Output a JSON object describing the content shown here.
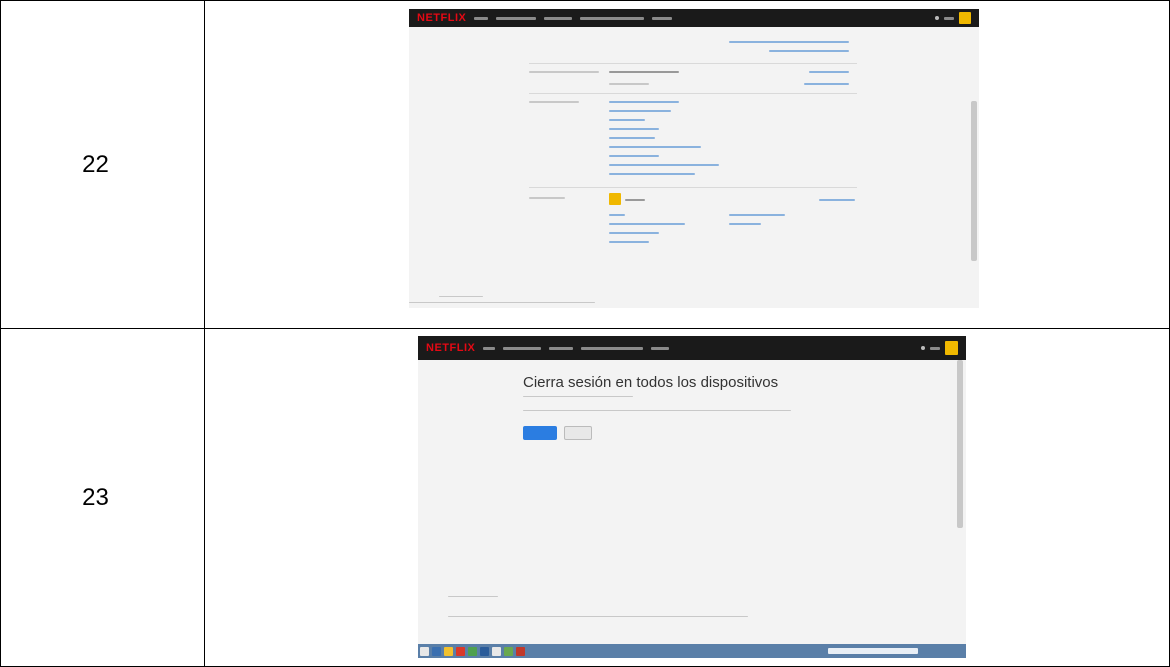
{
  "rows": [
    {
      "number": "22"
    },
    {
      "number": "23"
    }
  ],
  "screenshot_23": {
    "heading": "Cierra sesión en todos los dispositivos"
  },
  "netflix": {
    "logo_text": "NETFLIX",
    "brand_color": "#e50914",
    "header_color": "#1a1a1a",
    "link_color": "#8ab2de",
    "primary_button_color": "#2b7de1"
  }
}
